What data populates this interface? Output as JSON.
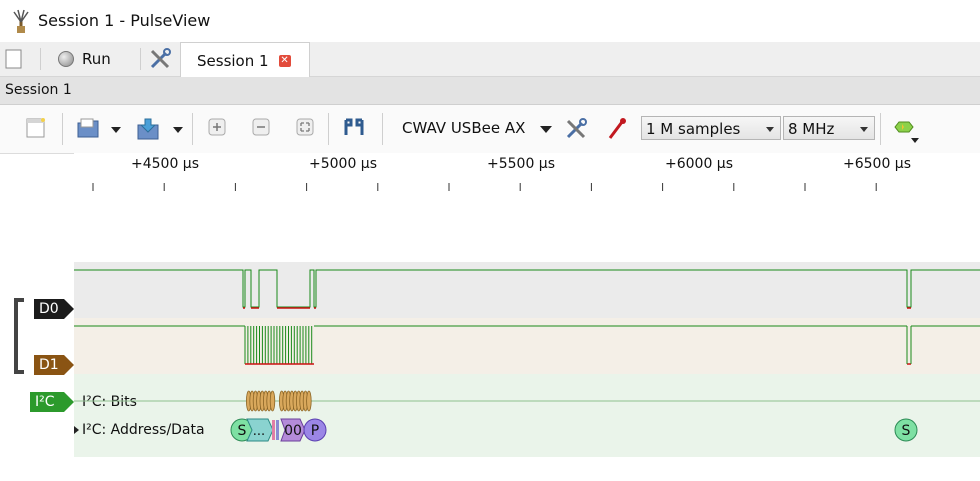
{
  "window": {
    "title": "Session 1 - PulseView"
  },
  "tabbar": {
    "run_label": "Run",
    "tab_label": "Session 1",
    "close_glyph": "✕"
  },
  "session_header": {
    "label": "Session 1"
  },
  "toolbar": {
    "device": "CWAV USBee AX",
    "samples": "1 M samples",
    "samplerate": "8 MHz"
  },
  "ruler": {
    "ticks": [
      {
        "label": "+4500 µs"
      },
      {
        "label": "+5000 µs"
      },
      {
        "label": "+5500 µs"
      },
      {
        "label": "+6000 µs"
      },
      {
        "label": "+6500 µs"
      }
    ]
  },
  "channels": [
    {
      "name": "D0",
      "color": "#1b1b1b"
    },
    {
      "name": "D1",
      "color": "#8a5413"
    }
  ],
  "decoder": {
    "name": "I²C",
    "color": "#2c9a2c",
    "rows": [
      {
        "label": "I²C: Bits"
      },
      {
        "label": "I²C: Address/Data"
      }
    ],
    "annotations": [
      {
        "text": "S"
      },
      {
        "text": "..."
      },
      {
        "text": "00"
      },
      {
        "text": "P"
      },
      {
        "text": "S"
      }
    ]
  },
  "colors": {
    "trace": "#1a8a1a",
    "low": "#cc1111",
    "bits_fill": "#d9a85c"
  }
}
